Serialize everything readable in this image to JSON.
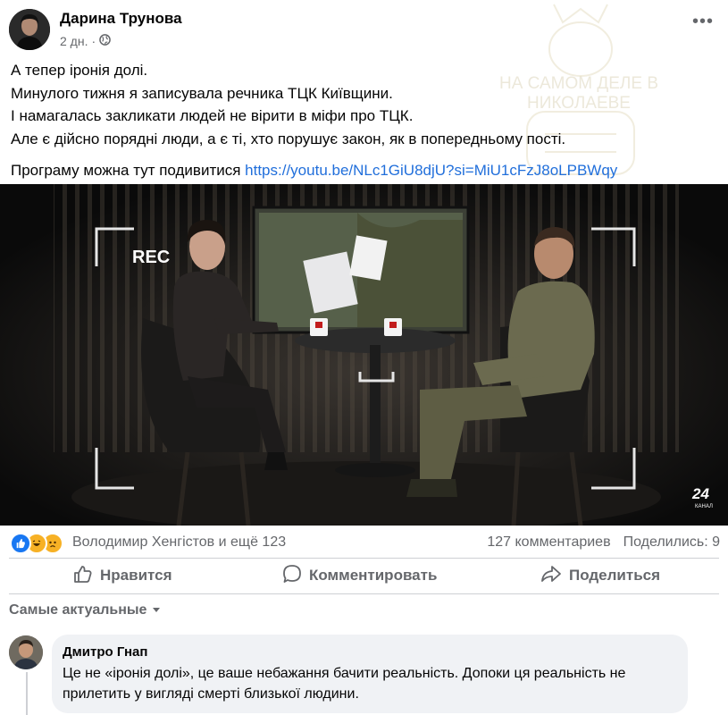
{
  "post": {
    "author": "Дарина Трунова",
    "time": "2 дн.",
    "separator": "·",
    "privacy_icon": "globe-icon",
    "more_label": "•••",
    "watermark": "НА САМОМ ДЕЛЕ В НИКОЛАЕВЕ",
    "lines": [
      "А тепер іронія долі.",
      "Минулого тижня я записувала речника ТЦК Київщини.",
      "І намагалась закликати людей не вірити в міфи про ТЦК.",
      "Але є дійсно порядні люди, а є ті, хто порушує закон, як в попередньому пості."
    ],
    "program_prefix": "Програму можна тут подивитися ",
    "link": "https://youtu.be/NLc1GiU8djU?si=MiU1cFzJ8oLPBWqy"
  },
  "media": {
    "rec_label": "REC",
    "channel_number": "24",
    "channel_word": "КАНАЛ"
  },
  "reactions": {
    "icons": [
      "like-icon",
      "haha-icon",
      "sad-icon"
    ],
    "names": "Володимир Хенгістов и ещё 123",
    "comments": "127 комментариев",
    "shares": "Поделились: 9"
  },
  "actions": {
    "like": "Нравится",
    "comment": "Комментировать",
    "share": "Поделиться"
  },
  "comments_sort": "Самые актуальные",
  "comment": {
    "author": "Дмитро Гнап",
    "text": "Це не «іронія долі», це ваше небажання бачити реальність. Допоки ця реальність не прилетить у вигляді смерті близької людини."
  },
  "colors": {
    "link": "#216fdb",
    "secondary_text": "#65676b",
    "bubble": "#f0f2f5",
    "like_blue": "#1877f2"
  }
}
